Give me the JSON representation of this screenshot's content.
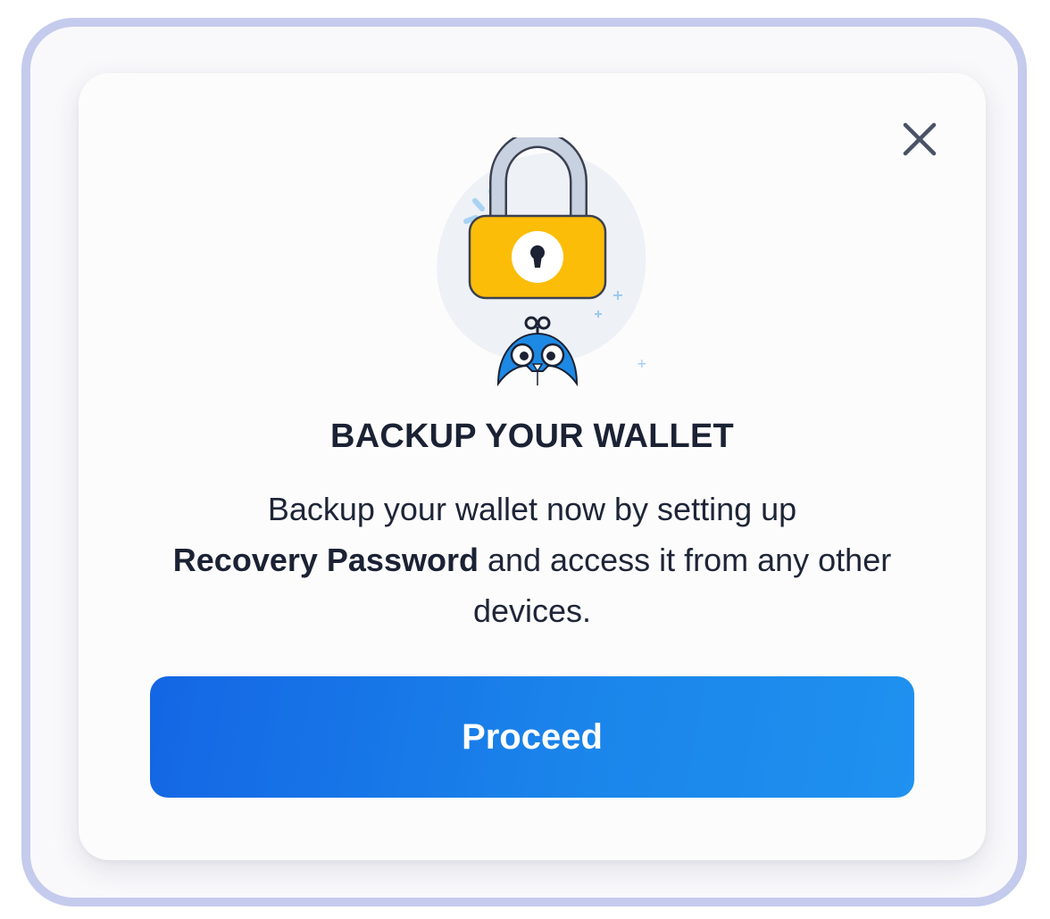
{
  "modal": {
    "title": "BACKUP YOUR WALLET",
    "description_before": "Backup your wallet now by setting up",
    "description_bold": "Recovery Password",
    "description_after": "and access it from any other devices.",
    "proceed_label": "Proceed"
  },
  "icons": {
    "close": "close-icon",
    "illustration": "padlock-illustration"
  },
  "colors": {
    "frame_border": "#c4cbec",
    "title_text": "#1b2233",
    "button_gradient_start": "#1466e4",
    "button_gradient_end": "#1f91ef",
    "lock_body": "#fbbd08",
    "mascot_blue": "#1e88e5"
  }
}
